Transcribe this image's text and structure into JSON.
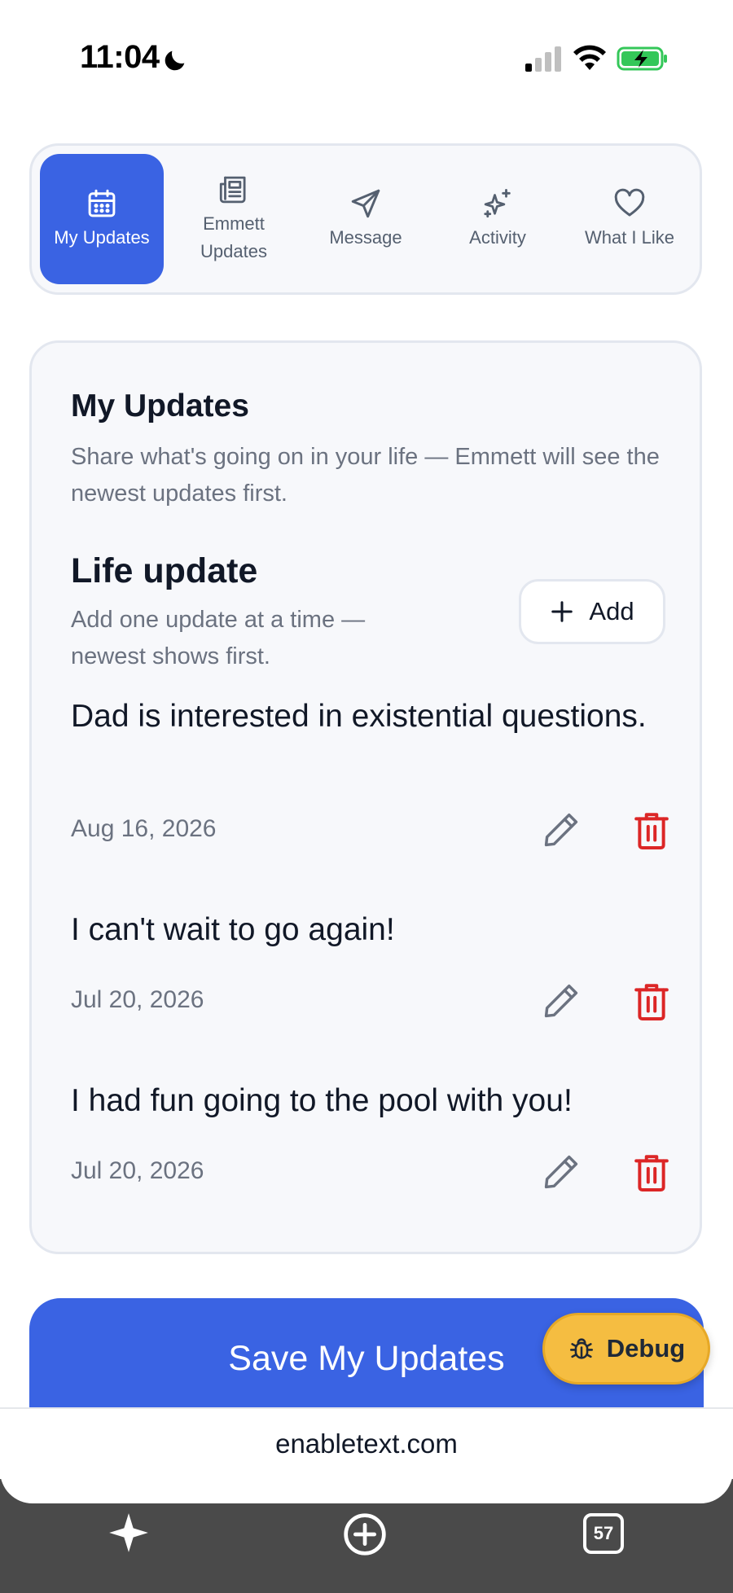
{
  "status_bar": {
    "time": "11:04",
    "icons": [
      "moon-icon",
      "signal-icon",
      "wifi-icon",
      "battery-charging-icon"
    ]
  },
  "tabs": [
    {
      "label": "My Updates",
      "icon": "calendar-icon",
      "active": true
    },
    {
      "label": "Emmett Updates",
      "icon": "newspaper-icon",
      "active": false
    },
    {
      "label": "Message",
      "icon": "send-icon",
      "active": false
    },
    {
      "label": "Activity",
      "icon": "sparkles-icon",
      "active": false
    },
    {
      "label": "What I Like",
      "icon": "heart-icon",
      "active": false
    }
  ],
  "card": {
    "title": "My Updates",
    "subtitle": "Share what's going on in your life — Emmett will see the newest updates first.",
    "section_title": "Life update",
    "section_subtitle": "Add one update at a time — newest shows first.",
    "add_label": "Add"
  },
  "updates": [
    {
      "text": "Dad is interested in existential questions.",
      "date": "Aug 16, 2026"
    },
    {
      "text": "I can't wait to go again!",
      "date": "Jul 20, 2026"
    },
    {
      "text": "I had fun going to the pool with you!",
      "date": "Jul 20, 2026"
    }
  ],
  "save_label": "Save My Updates",
  "debug_label": "Debug",
  "url": "enabletext.com",
  "browser": {
    "tab_count": "57"
  },
  "colors": {
    "accent": "#3a63e3",
    "delete": "#dc2626",
    "debug": "#f5bd41"
  }
}
